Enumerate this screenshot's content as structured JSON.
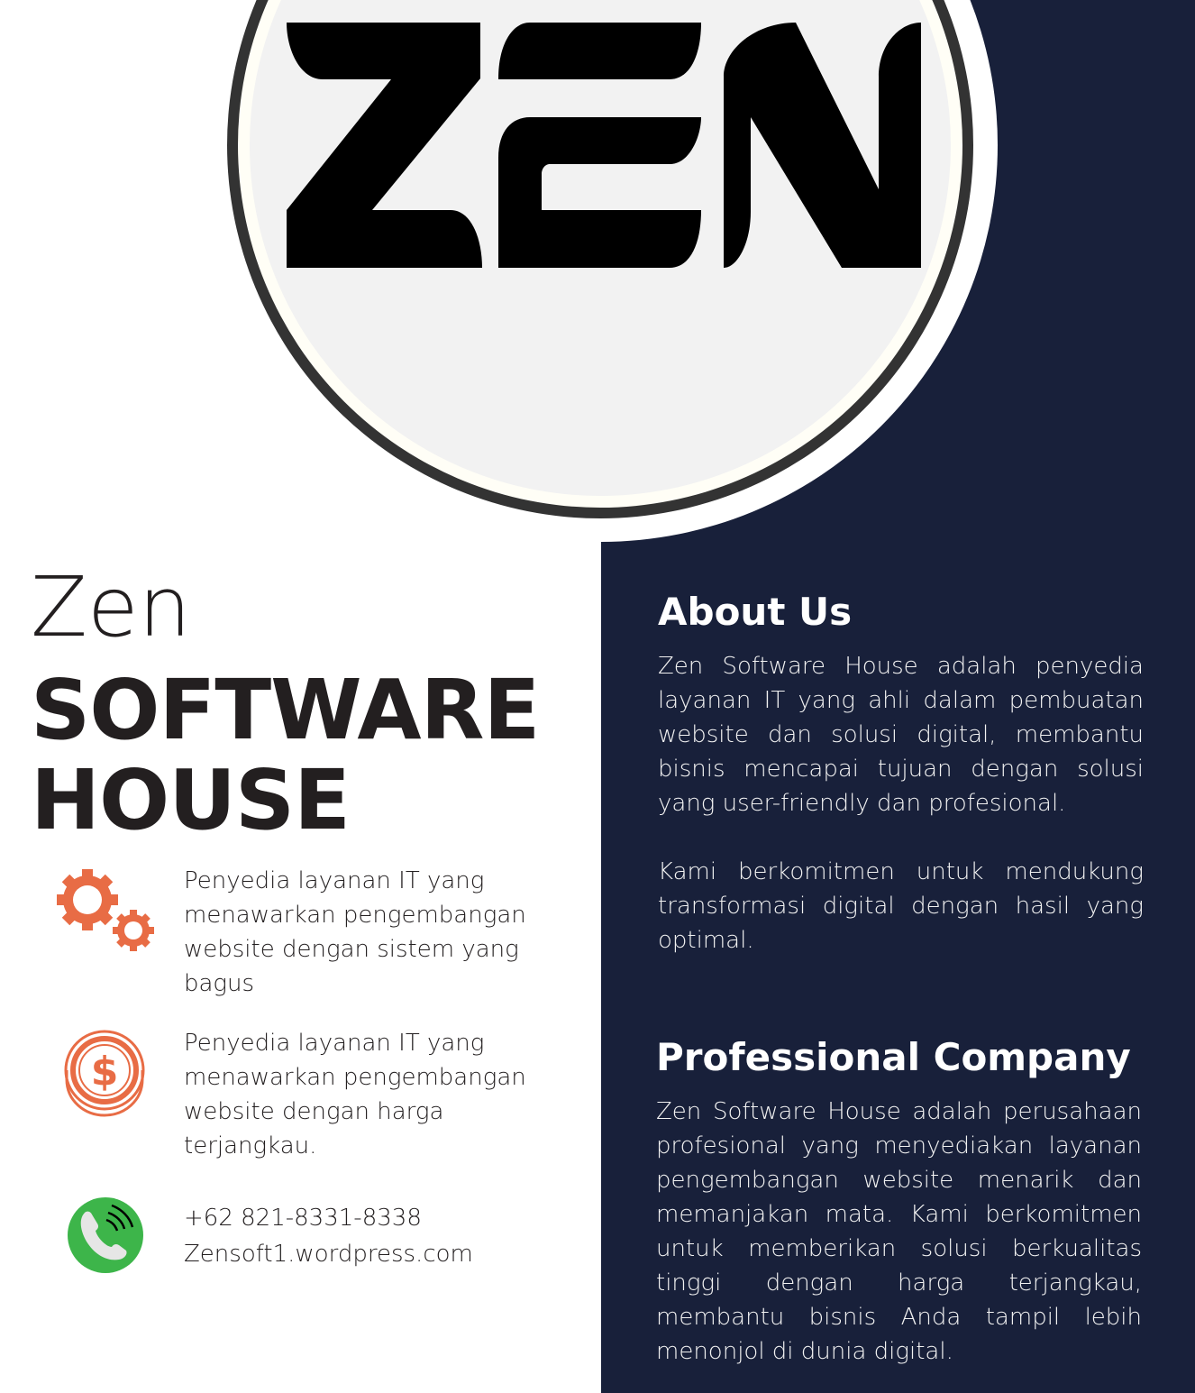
{
  "logo": {
    "text": "ZEN"
  },
  "title": {
    "line1": "Zen",
    "line2": "SOFTWARE",
    "line3": "HOUSE"
  },
  "features": [
    {
      "icon": "gears-icon",
      "text": "Penyedia layanan IT yang menawarkan pengembangan website dengan sistem yang bagus"
    },
    {
      "icon": "dollar-coin-icon",
      "text": "Penyedia layanan IT yang menawarkan pengembangan website dengan harga terjangkau."
    }
  ],
  "contact": {
    "icon": "phone-icon",
    "phone": "+62 821-8331-8338",
    "website": "Zensoft1.wordpress.com"
  },
  "about": {
    "heading": "About Us",
    "p1": "Zen Software House adalah penyedia layanan IT yang ahli dalam pembuatan website dan solusi digital, membantu bisnis mencapai tujuan dengan solusi yang user-friendly dan profesional.",
    "p2": "Kami berkomitmen untuk mendukung transformasi digital dengan hasil yang optimal."
  },
  "professional": {
    "heading": "Professional Company",
    "p1": "Zen Software House adalah perusahaan profesional yang menyediakan layanan pengembangan website menarik dan memanjakan mata. Kami berkomitmen untuk memberikan solusi berkualitas tinggi dengan harga terjangkau, membantu bisnis Anda tampil lebih menonjol di dunia digital."
  },
  "colors": {
    "navy": "#18203a",
    "accent": "#e86c45",
    "green": "#3db54a"
  }
}
